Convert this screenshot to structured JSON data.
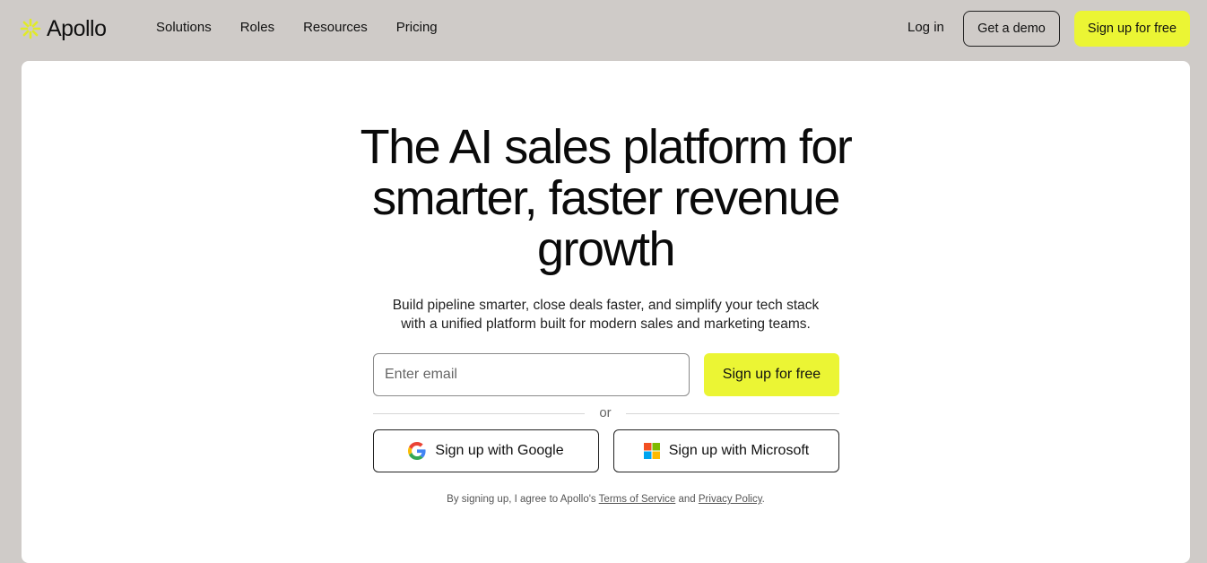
{
  "nav": {
    "logo_text": "Apollo",
    "links": [
      "Solutions",
      "Roles",
      "Resources",
      "Pricing"
    ],
    "login": "Log in",
    "demo": "Get a demo",
    "signup": "Sign up for free"
  },
  "hero": {
    "headline_lines": [
      "The AI sales platform for",
      "smarter, faster revenue",
      "growth"
    ],
    "sub_lines": [
      "Build pipeline smarter, close deals faster, and simplify your tech stack",
      "with a unified platform built for modern sales and marketing teams."
    ],
    "email_placeholder": "Enter email",
    "signup_label": "Sign up for free",
    "or_label": "or",
    "google_label": "Sign up with Google",
    "microsoft_label": "Sign up with Microsoft"
  },
  "terms": {
    "prefix": "By signing up, I agree to Apollo's ",
    "tos": "Terms of Service",
    "and": " and ",
    "privacy": "Privacy Policy",
    "suffix": "."
  },
  "colors": {
    "accent": "#ebf534",
    "background": "#cfcbc8",
    "card": "#ffffff"
  }
}
